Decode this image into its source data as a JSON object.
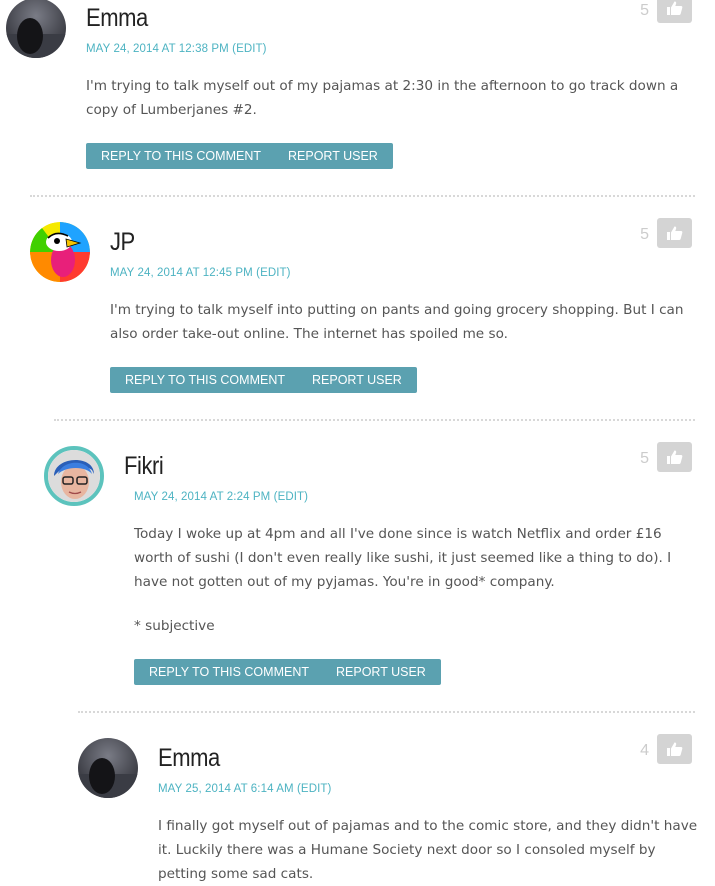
{
  "comments": [
    {
      "author": "Emma",
      "date": "MAY 24, 2014 AT 12:38 PM",
      "edit": "(EDIT)",
      "score": "5",
      "text": [
        "I'm trying to talk myself out of my pajamas at 2:30 in the afternoon to go track down a copy of Lumberjanes #2."
      ],
      "reply_label": "REPLY TO THIS COMMENT",
      "report_label": "REPORT USER"
    },
    {
      "author": "JP",
      "date": "MAY 24, 2014 AT 12:45 PM",
      "edit": "(EDIT)",
      "score": "5",
      "text": [
        "I'm trying to talk myself into putting on pants and going grocery shopping. But I can also order take-out online. The internet has spoiled me so."
      ],
      "reply_label": "REPLY TO THIS COMMENT",
      "report_label": "REPORT USER"
    },
    {
      "author": "Fikri",
      "date": "MAY 24, 2014 AT 2:24 PM",
      "edit": "(EDIT)",
      "score": "5",
      "text": [
        "Today I woke up at 4pm and all I've done since is watch Netflix and order £16 worth of sushi (I don't even really like sushi, it just seemed like a thing to do). I have not gotten out of my pyjamas. You're in good* company.",
        "* subjective"
      ],
      "reply_label": "REPLY TO THIS COMMENT",
      "report_label": "REPORT USER"
    },
    {
      "author": "Emma",
      "date": "MAY 25, 2014 AT 6:14 AM",
      "edit": "(EDIT)",
      "score": "4",
      "text": [
        "I finally got myself out of pajamas and to the comic store, and they didn't have it. Luckily there was a Humane Society next door so I consoled myself by petting some sad cats."
      ],
      "reply_label": "",
      "report_label": ""
    }
  ],
  "icons": {
    "like": "thumbs-up-icon"
  },
  "colors": {
    "accent": "#4db3c2",
    "button": "#5ba1b0",
    "like_bg": "#d4d4d4"
  }
}
